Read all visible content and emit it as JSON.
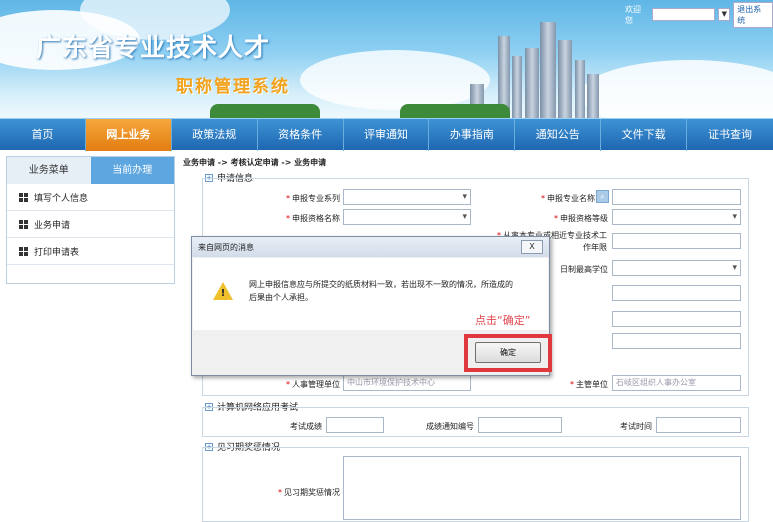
{
  "header": {
    "site_title": "广东省专业技术人才",
    "sub_title": "职称管理系统",
    "welcome_label": "欢迎您",
    "logout_label": "退出系统"
  },
  "nav": [
    "首页",
    "网上业务",
    "政策法规",
    "资格条件",
    "评审通知",
    "办事指南",
    "通知公告",
    "文件下载",
    "证书查询"
  ],
  "sidebar": {
    "tabs": [
      "业务菜单",
      "当前办理"
    ],
    "items": [
      "填写个人信息",
      "业务申请",
      "打印申请表"
    ]
  },
  "breadcrumb": "业务申请 -> 考核认定申请 -> 业务申请",
  "sections": {
    "apply_info": "申请信息",
    "computer_exam": "计算机网络应用考试",
    "internship": "见习期奖惩情况"
  },
  "form": {
    "series_label": "申报专业系列",
    "major_name_label": "申报专业名称",
    "qual_name_label": "申报资格名称",
    "qual_level_label": "申报资格等级",
    "years_label_line1": "从事本专业或相近专业技术工",
    "years_label_line2": "作年限",
    "edu_label": "日制最高学位",
    "hr_unit_label": "人事管理单位",
    "hr_unit_value": "中山市环境保护技术中心",
    "supervisor_label": "主管单位",
    "supervisor_value": "石岐区组织人事办公室",
    "exam_score_label": "考试成绩",
    "score_notice_label": "成绩通知编号",
    "exam_time_label": "考试时间",
    "internship_label": "见习期奖惩情况"
  },
  "dialog": {
    "title": "来自网页的消息",
    "close_label": "X",
    "message": "网上申报信息应与所提交的纸质材料一致，若出现不一致的情况，所造成的后果由个人承担。",
    "hint": "点击“确定”",
    "ok_label": "确定"
  },
  "icons": {
    "warning": "warning-triangle-icon",
    "dropdown": "chevron-down-icon",
    "grid": "grid-icon",
    "expand": "plus-square-icon"
  },
  "colors": {
    "nav_bg": "#1f67b1",
    "nav_active": "#e27d12",
    "highlight": "#e0383f",
    "hint_text": "#e2464f",
    "warning": "#f0c02c"
  }
}
